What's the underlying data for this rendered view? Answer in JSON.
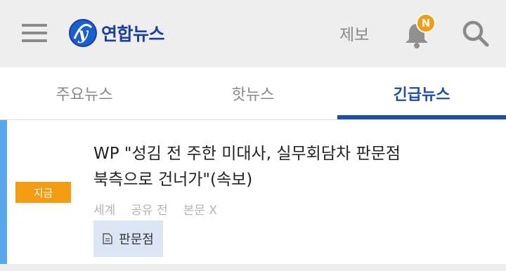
{
  "header": {
    "logo_text": "연합뉴스",
    "report_label": "제보",
    "notification_badge": "N",
    "badge_color": "#f39c12",
    "brand_color": "#1a3fa0"
  },
  "tabs": [
    {
      "label": "주요뉴스",
      "active": false
    },
    {
      "label": "핫뉴스",
      "active": false
    },
    {
      "label": "긴급뉴스",
      "active": true
    }
  ],
  "article": {
    "badge": "지금",
    "headline_line1": "WP \"성김 전 주한 미대사, 실무회담차 판문점",
    "headline_line2": "북측으로 건너가\"(속보)",
    "meta": {
      "section": "세계",
      "share": "공유 전",
      "body": "본문 X"
    },
    "tag": "판문점",
    "accent_color": "#5ba7ee"
  },
  "icons": [
    "menu-icon",
    "logo-icon",
    "bell-icon",
    "search-icon",
    "document-icon"
  ]
}
